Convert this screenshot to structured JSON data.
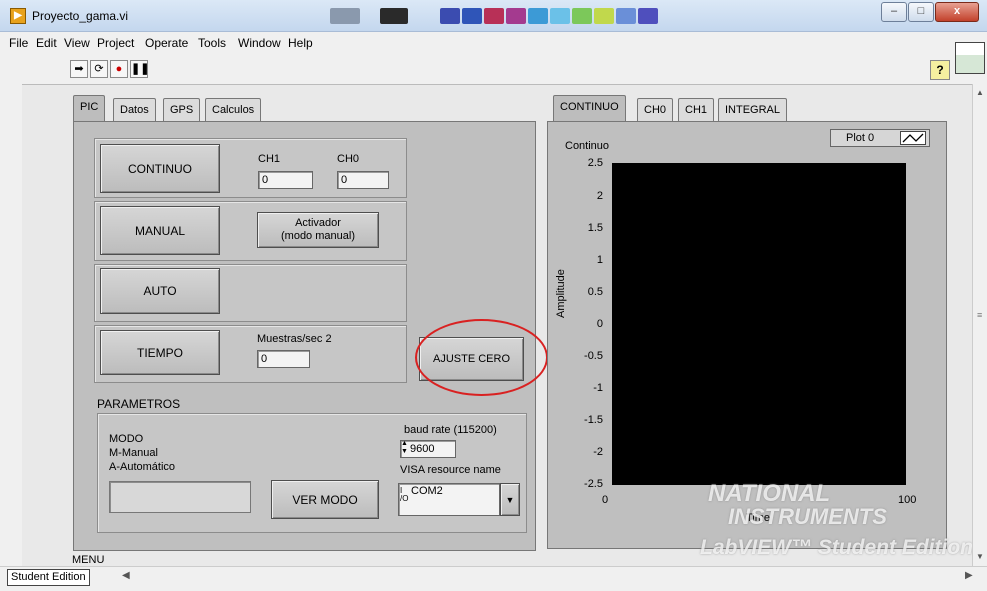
{
  "window": {
    "title": "Proyecto_gama.vi",
    "minimize": "–",
    "maximize": "□",
    "close": "x"
  },
  "menu": [
    "File",
    "Edit",
    "View",
    "Project",
    "Operate",
    "Tools",
    "Window",
    "Help"
  ],
  "toolbar": {
    "run_icon": "run-arrow-icon",
    "run_continuous_icon": "run-continuous-icon",
    "abort_icon": "abort-icon",
    "pause_icon": "pause-icon",
    "help": "?"
  },
  "left_tabs": [
    "PIC",
    "Datos",
    "GPS",
    "Calculos"
  ],
  "left_active_tab": "PIC",
  "controls": {
    "continuo_button": "CONTINUO",
    "ch1_label": "CH1",
    "ch1_value": "0",
    "ch0_label": "CH0",
    "ch0_value": "0",
    "manual_button": "MANUAL",
    "activador_line1": "Activador",
    "activador_line2": "(modo manual)",
    "auto_button": "AUTO",
    "tiempo_button": "TIEMPO",
    "muestras_label": "Muestras/sec 2",
    "muestras_value": "0",
    "ajuste_cero_button": "AJUSTE CERO"
  },
  "parametros": {
    "title": "PARAMETROS",
    "modo_lines": [
      "MODO",
      "M-Manual",
      "A-Automático"
    ],
    "ver_modo_button": "VER MODO",
    "baud_label": "baud rate (115200)",
    "baud_value": "9600",
    "visa_label": "VISA resource name",
    "visa_prefix": "I/O",
    "visa_value": "COM2"
  },
  "menu_label": "MENU",
  "right_tabs": [
    "CONTINUO",
    "CH0",
    "CH1",
    "INTEGRAL"
  ],
  "right_active_tab": "CONTINUO",
  "graph": {
    "title": "Continuo",
    "legend": "Plot 0",
    "ylabel": "Amplitude",
    "xlabel": "Time",
    "yticks": [
      "2.5",
      "2",
      "1.5",
      "1",
      "0.5",
      "0",
      "-0.5",
      "-1",
      "-1.5",
      "-2",
      "-2.5"
    ],
    "xticks": [
      "0",
      "100"
    ]
  },
  "watermark": {
    "line1": "NATIONAL",
    "line2": "INSTRUMENTS",
    "line3": "LabVIEW™ Student Edition"
  },
  "status": {
    "edition": "Student Edition"
  }
}
